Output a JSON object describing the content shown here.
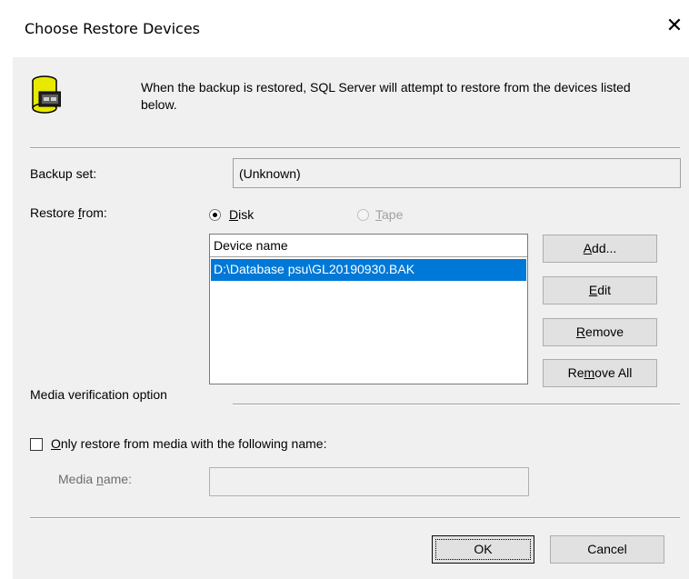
{
  "dialog": {
    "title": "Choose Restore Devices",
    "close_glyph": "✕",
    "intro_text": "When the backup is restored, SQL Server will attempt to restore from the devices listed below."
  },
  "backup_set": {
    "label": "Backup set:",
    "value": "(Unknown)"
  },
  "restore_from": {
    "label_pre": "Restore ",
    "label_ul": "f",
    "label_post": "rom:",
    "disk": {
      "ul": "D",
      "rest": "isk",
      "checked": true
    },
    "tape": {
      "ul": "T",
      "rest": "ape",
      "checked": false,
      "disabled": true
    }
  },
  "device_list": {
    "header": "Device name",
    "items": [
      "D:\\Database psu\\GL20190930.BAK"
    ]
  },
  "side_buttons": {
    "add": {
      "ul": "A",
      "rest": "dd..."
    },
    "edit": {
      "ul": "E",
      "rest": "dit"
    },
    "remove": {
      "ul": "R",
      "rest": "emove"
    },
    "remove_all": {
      "pre": "Re",
      "ul": "m",
      "rest": "ove All"
    }
  },
  "media_verification": {
    "label": "Media verification option"
  },
  "only_restore": {
    "ul": "O",
    "rest": "nly restore from media with the following name:",
    "checked": false
  },
  "media_name": {
    "label_pre": "Media ",
    "label_ul": "n",
    "label_post": "ame:",
    "value": ""
  },
  "footer": {
    "ok": "OK",
    "cancel": "Cancel"
  },
  "colors": {
    "selection": "#0078d7",
    "dialog_bg": "#f0f0f0"
  },
  "icons": {
    "dialog_icon": "database-backup-icon"
  }
}
